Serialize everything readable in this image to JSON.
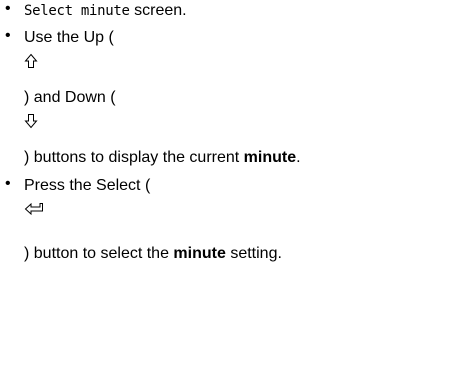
{
  "steps": [
    {
      "mono_text": "Select minute",
      "text": " screen."
    },
    {
      "text_before_up": "Use the Up (",
      "text_before_down": ") and Down (",
      "text_after": ") buttons to display the current ",
      "bold": "minute",
      "end": "."
    },
    {
      "text_before_icon": "Press the Select (",
      "text_after": ") button to select the ",
      "bold": "minute",
      "end": " setting."
    }
  ],
  "icons": {
    "up": "up-arrow-icon",
    "down": "down-arrow-icon",
    "select": "enter-return-icon"
  }
}
